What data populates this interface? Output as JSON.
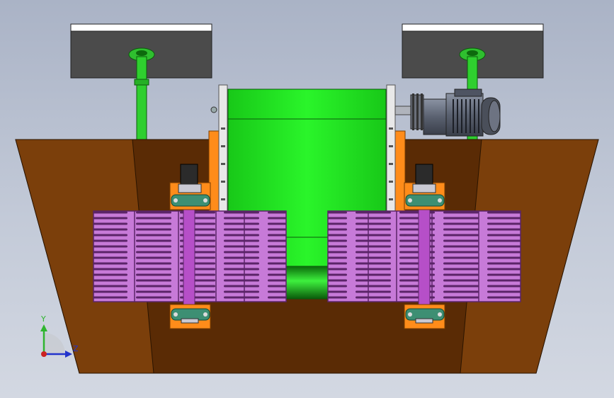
{
  "viewport": {
    "background_top": "#aab3c6",
    "background_bottom": "#d3d8e2"
  },
  "colors": {
    "basin_side": "#7b3f0b",
    "basin_floor": "#5a2b05",
    "drum": "#22ee22",
    "pipe": "#2fbf2f",
    "screen_panel": "#c77ad8",
    "screen_slot": "#6a2a78",
    "frame_orange": "#ff8c1a",
    "bearing_green": "#3d8f73",
    "motor_body": "#5e6574",
    "tank": "#4c4c4c",
    "axis_y": "#2fb52f",
    "axis_z": "#2233cc",
    "axis_origin": "#cc2222"
  },
  "components": {
    "drum": "rotary-drum",
    "motor": "gear-motor-icon",
    "pipes": [
      "left-water-pipe",
      "right-water-pipe"
    ],
    "tanks": [
      "left-tank",
      "right-tank"
    ]
  },
  "triad": {
    "y_label": "Y",
    "z_label": "Z"
  }
}
